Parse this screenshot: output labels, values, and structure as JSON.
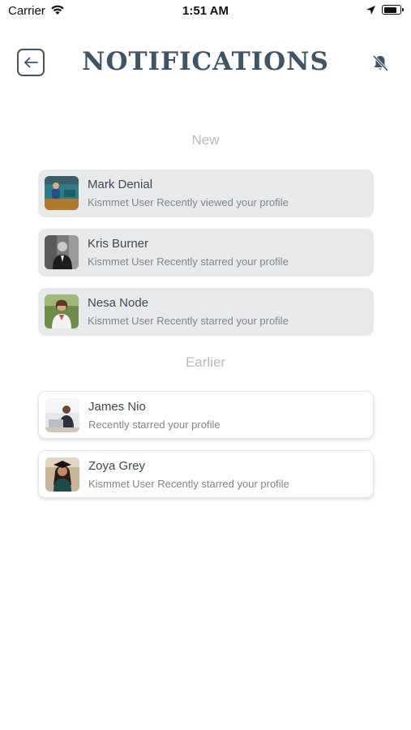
{
  "status_bar": {
    "carrier": "Carrier",
    "time": "1:51 AM",
    "battery_level": 0.85
  },
  "header": {
    "title": "NOTIFICATIONS",
    "back_icon": "arrow-left-icon",
    "bell_icon": "bell-off-icon"
  },
  "sections": {
    "new_label": "New",
    "earlier_label": "Earlier"
  },
  "notifications": {
    "new": [
      {
        "name": "Mark Denial",
        "message": "Kismmet User Recently viewed your profile"
      },
      {
        "name": "Kris Burner",
        "message": "Kismmet User Recently starred your profile"
      },
      {
        "name": "Nesa Node",
        "message": "Kismmet User Recently starred your profile"
      }
    ],
    "earlier": [
      {
        "name": "James Nio",
        "message": "Recently starred your profile"
      },
      {
        "name": "Zoya Grey",
        "message": "Kismmet User Recently starred your profile"
      }
    ]
  },
  "colors": {
    "primary": "#3f5566",
    "new_card_bg": "#e8e9ea",
    "earlier_card_bg": "#ffffff",
    "section_label": "#b6bcc2"
  }
}
